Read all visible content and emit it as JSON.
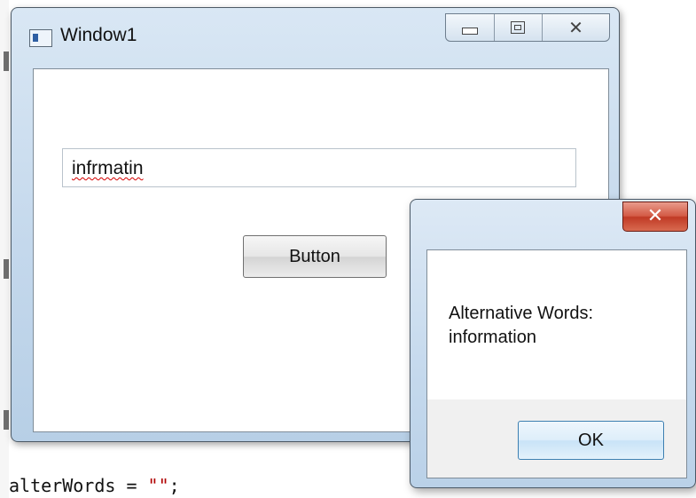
{
  "main_window": {
    "title": "Window1",
    "textbox_value": "infrmatin",
    "button_label": "Button"
  },
  "message_box": {
    "line1": "Alternative Words:",
    "line2": "information",
    "ok_label": "OK"
  },
  "code_editor": {
    "visible_line_prefix": "alterWords = ",
    "visible_line_string": "\"\"",
    "visible_line_suffix": ";"
  },
  "colors": {
    "close_button": "#c9472f",
    "spelling_underline": "#d40000",
    "code_string": "#b00000"
  }
}
